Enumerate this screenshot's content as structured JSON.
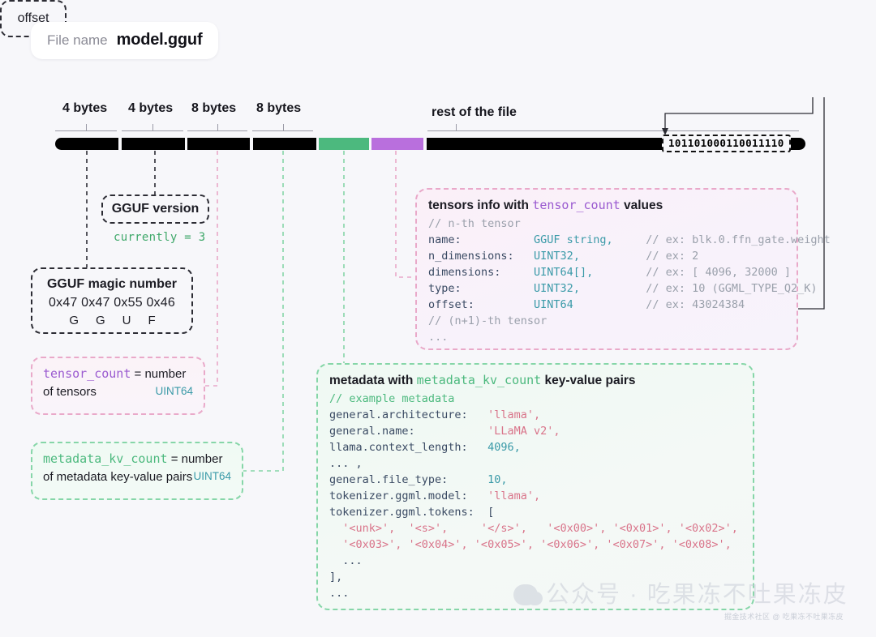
{
  "file": {
    "label": "File name",
    "value": "model.gguf"
  },
  "ruler": {
    "segments": [
      {
        "label": "4 bytes"
      },
      {
        "label": "4 bytes"
      },
      {
        "label": "8 bytes"
      },
      {
        "label": "8 bytes"
      }
    ],
    "rest_label": "rest of the file"
  },
  "bar": {
    "offset_bits": "101101000110011110"
  },
  "offset_box": {
    "label": "offset"
  },
  "gguf_version": {
    "title": "GGUF version",
    "note": "currently = 3"
  },
  "magic": {
    "title": "GGUF magic number",
    "hex": "0x47 0x47 0x55 0x46",
    "chars": "GGUF"
  },
  "tensor_count": {
    "name": "tensor_count",
    "eq": " = number",
    "line2": "of tensors",
    "type": "UINT64"
  },
  "metadata_kv_count": {
    "name": "metadata_kv_count",
    "eq": " = number",
    "line2": "of metadata key-value pairs",
    "type": "UINT64"
  },
  "tensors_panel": {
    "title_pre": "tensors info with ",
    "title_code": "tensor_count",
    "title_post": " values",
    "rows": [
      {
        "comment_only": "// n-th tensor"
      },
      {
        "field": "name:",
        "type": "GGUF string,",
        "comment": "// ex: blk.0.ffn_gate.weight"
      },
      {
        "field": "n_dimensions:",
        "type": "UINT32,",
        "comment": "// ex: 2"
      },
      {
        "field": "dimensions:",
        "type": "UINT64[],",
        "comment": "// ex: [ 4096, 32000 ]"
      },
      {
        "field": "type:",
        "type": "UINT32,",
        "comment": "// ex: 10 (GGML_TYPE_Q2_K)"
      },
      {
        "field": "offset:",
        "type": "UINT64",
        "comment": "// ex: 43024384"
      },
      {
        "comment_only": "// (n+1)-th tensor"
      },
      {
        "comment_only": "..."
      }
    ]
  },
  "metadata_panel": {
    "title_pre": "metadata with ",
    "title_code": "metadata_kv_count",
    "title_post": " key-value pairs",
    "rows": [
      {
        "kind": "comment",
        "text": "// example metadata"
      },
      {
        "kind": "kv",
        "key": "general.architecture:",
        "value": "'llama',",
        "vtype": "str"
      },
      {
        "kind": "kv",
        "key": "general.name:",
        "value": "'LLaMA v2',",
        "vtype": "str"
      },
      {
        "kind": "kv",
        "key": "llama.context_length:",
        "value": "4096,",
        "vtype": "num"
      },
      {
        "kind": "plain",
        "text": "... ,"
      },
      {
        "kind": "kv",
        "key": "general.file_type:",
        "value": "10,",
        "vtype": "num"
      },
      {
        "kind": "kv",
        "key": "tokenizer.ggml.model:",
        "value": "'llama',",
        "vtype": "str"
      },
      {
        "kind": "kv",
        "key": "tokenizer.ggml.tokens:",
        "value": "[",
        "vtype": "plain"
      },
      {
        "kind": "tokens",
        "text": "  '<unk>',  '<s>',     '</s>',   '<0x00>', '<0x01>', '<0x02>',"
      },
      {
        "kind": "tokens",
        "text": "  '<0x03>', '<0x04>', '<0x05>', '<0x06>', '<0x07>', '<0x08>',"
      },
      {
        "kind": "plain",
        "text": "  ..."
      },
      {
        "kind": "plain",
        "text": "],"
      },
      {
        "kind": "plain",
        "text": "..."
      }
    ]
  },
  "watermark": {
    "main": "公众号 · 吃果冻不吐果冻皮",
    "sub": "掘金技术社区 @ 吃果冻不吐果冻皮"
  },
  "colors": {
    "green": "#4cb97e",
    "purple": "#b96fdd",
    "pink_dash": "#e9a9c9",
    "green_dash": "#86d6a8",
    "teal_text": "#3a9aa8"
  }
}
